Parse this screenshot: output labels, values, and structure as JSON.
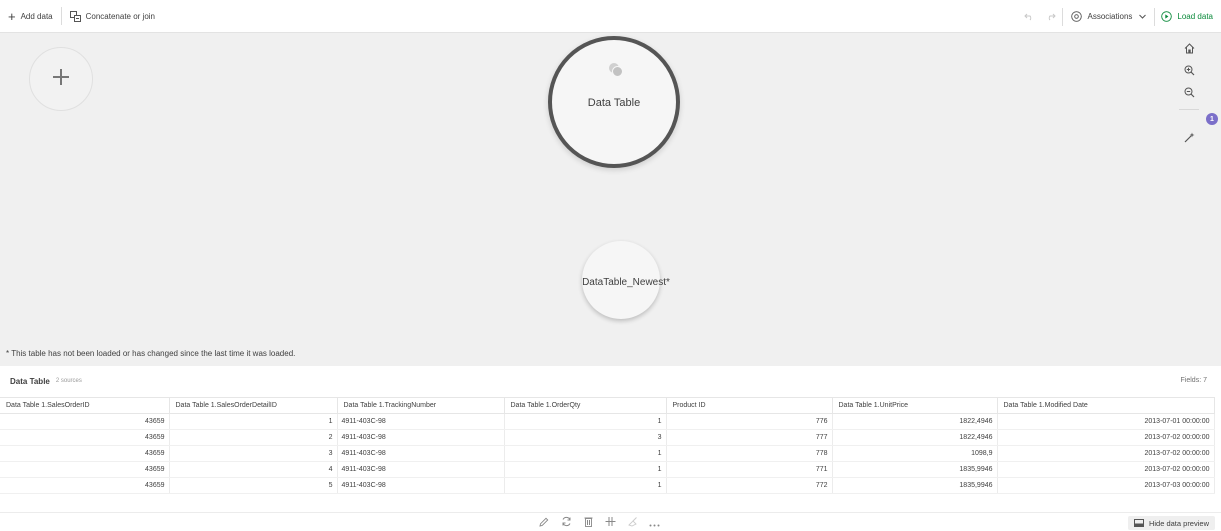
{
  "toolbar": {
    "add_data_label": "Add data",
    "concat_label": "Concatenate or join",
    "associations_label": "Associations",
    "load_data_label": "Load data",
    "accent_color": "#0b8a3b"
  },
  "canvas": {
    "main_table_label": "Data Table",
    "new_table_label": "DataTable_Newest*",
    "recommendations_badge": "1",
    "footnote": "* This table has not been loaded or has changed since the last time it was loaded."
  },
  "preview": {
    "title": "Data Table",
    "sources": "2 sources",
    "fields": "Fields: 7",
    "columns": [
      "Data Table 1.SalesOrderID",
      "Data Table 1.SalesOrderDetailID",
      "Data Table 1.TrackingNumber",
      "Data Table 1.OrderQty",
      "Product ID",
      "Data Table 1.UnitPrice",
      "Data Table 1.Modified Date"
    ],
    "rows": [
      [
        "43659",
        "1",
        "4911-403C-98",
        "1",
        "776",
        "1822,4946",
        "2013-07-01 00:00:00"
      ],
      [
        "43659",
        "2",
        "4911-403C-98",
        "3",
        "777",
        "1822,4946",
        "2013-07-02 00:00:00"
      ],
      [
        "43659",
        "3",
        "4911-403C-98",
        "1",
        "778",
        "1098,9",
        "2013-07-02 00:00:00"
      ],
      [
        "43659",
        "4",
        "4911-403C-98",
        "1",
        "771",
        "1835,9946",
        "2013-07-02 00:00:00"
      ],
      [
        "43659",
        "5",
        "4911-403C-98",
        "1",
        "772",
        "1835,9946",
        "2013-07-03 00:00:00"
      ]
    ]
  },
  "bottombar": {
    "hide_preview_label": "Hide data preview"
  }
}
